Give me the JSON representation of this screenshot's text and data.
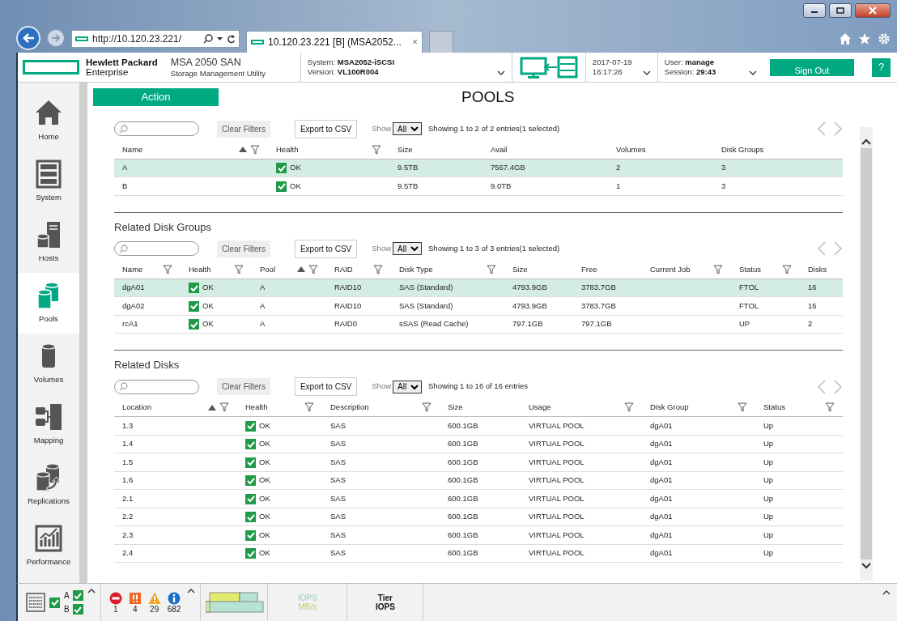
{
  "browser": {
    "address": "http://10.120.23.221/",
    "tab_title": "10.120.23.221 [B] (MSA2052...",
    "tab_close": "×"
  },
  "header": {
    "brand_line1": "Hewlett Packard",
    "brand_line2": "Enterprise",
    "product": "MSA 2050 SAN",
    "product_sub": "Storage Management Utility",
    "system_label": "System:",
    "system": "MSA2052-iSCSI",
    "version_label": "Version:",
    "version": "VL100R004",
    "date": "2017-07-19",
    "time": "16:17:26",
    "user_label": "User:",
    "user": "manage",
    "session_label": "Session:",
    "session": "29:43",
    "sign_out": "Sign Out",
    "help": "?"
  },
  "sidebar": {
    "items": [
      {
        "label": "Home",
        "selected": false
      },
      {
        "label": "System",
        "selected": false
      },
      {
        "label": "Hosts",
        "selected": false
      },
      {
        "label": "Pools",
        "selected": true
      },
      {
        "label": "Volumes",
        "selected": false
      },
      {
        "label": "Mapping",
        "selected": false
      },
      {
        "label": "Replications",
        "selected": false
      },
      {
        "label": "Performance",
        "selected": false
      }
    ]
  },
  "action_button": "Action",
  "page_title": "POOLS",
  "sections": [
    {
      "clear_filters": "Clear Filters",
      "export": "Export to CSV",
      "show_label": "Show",
      "show_value": "All",
      "summary": "Showing 1 to 2 of 2 entries(1 selected)",
      "columns": [
        {
          "label": "Name",
          "sorted": true,
          "filter": true,
          "kind": "text"
        },
        {
          "label": "Health",
          "sorted": false,
          "filter": true,
          "kind": "health"
        },
        {
          "label": "Size",
          "sorted": false,
          "filter": false,
          "kind": "text"
        },
        {
          "label": "Avail",
          "sorted": false,
          "filter": false,
          "kind": "text"
        },
        {
          "label": "Volumes",
          "sorted": false,
          "filter": false,
          "kind": "text"
        },
        {
          "label": "Disk Groups",
          "sorted": false,
          "filter": false,
          "kind": "text"
        }
      ],
      "rows": [
        {
          "selected": true,
          "cells": [
            "A",
            "OK",
            "9.5TB",
            "7567.4GB",
            "2",
            "3"
          ]
        },
        {
          "selected": false,
          "cells": [
            "B",
            "OK",
            "9.5TB",
            "9.0TB",
            "1",
            "3"
          ]
        }
      ]
    },
    {
      "title": "Related Disk Groups",
      "clear_filters": "Clear Filters",
      "export": "Export to CSV",
      "show_label": "Show",
      "show_value": "All",
      "summary": "Showing 1 to 3 of 3 entries(1 selected)",
      "columns": [
        {
          "label": "Name",
          "sorted": false,
          "filter": true,
          "kind": "text"
        },
        {
          "label": "Health",
          "sorted": false,
          "filter": true,
          "kind": "health"
        },
        {
          "label": "Pool",
          "sorted": true,
          "filter": true,
          "kind": "text"
        },
        {
          "label": "RAID",
          "sorted": false,
          "filter": true,
          "kind": "text"
        },
        {
          "label": "Disk Type",
          "sorted": false,
          "filter": true,
          "kind": "text"
        },
        {
          "label": "Size",
          "sorted": false,
          "filter": false,
          "kind": "text"
        },
        {
          "label": "Free",
          "sorted": false,
          "filter": false,
          "kind": "text"
        },
        {
          "label": "Current Job",
          "sorted": false,
          "filter": true,
          "kind": "text"
        },
        {
          "label": "Status",
          "sorted": false,
          "filter": true,
          "kind": "text"
        },
        {
          "label": "Disks",
          "sorted": false,
          "filter": false,
          "kind": "text"
        }
      ],
      "rows": [
        {
          "selected": true,
          "cells": [
            "dgA01",
            "OK",
            "A",
            "RAID10",
            "SAS (Standard)",
            "4793.9GB",
            "3783.7GB",
            "",
            "FTOL",
            "16"
          ]
        },
        {
          "selected": false,
          "cells": [
            "dgA02",
            "OK",
            "A",
            "RAID10",
            "SAS (Standard)",
            "4793.9GB",
            "3783.7GB",
            "",
            "FTOL",
            "16"
          ]
        },
        {
          "selected": false,
          "cells": [
            "rcA1",
            "OK",
            "A",
            "RAID0",
            "sSAS (Read Cache)",
            "797.1GB",
            "797.1GB",
            "",
            "UP",
            "2"
          ]
        }
      ]
    },
    {
      "title": "Related Disks",
      "clear_filters": "Clear Filters",
      "export": "Export to CSV",
      "show_label": "Show",
      "show_value": "All",
      "summary": "Showing 1 to 16 of 16 entries",
      "columns": [
        {
          "label": "Location",
          "sorted": true,
          "filter": true,
          "kind": "text"
        },
        {
          "label": "Health",
          "sorted": false,
          "filter": true,
          "kind": "health"
        },
        {
          "label": "Description",
          "sorted": false,
          "filter": true,
          "kind": "text"
        },
        {
          "label": "Size",
          "sorted": false,
          "filter": false,
          "kind": "text"
        },
        {
          "label": "Usage",
          "sorted": false,
          "filter": true,
          "kind": "text"
        },
        {
          "label": "Disk Group",
          "sorted": false,
          "filter": true,
          "kind": "text"
        },
        {
          "label": "Status",
          "sorted": false,
          "filter": true,
          "kind": "text"
        }
      ],
      "rows": [
        {
          "selected": false,
          "cells": [
            "1.3",
            "OK",
            "SAS",
            "600.1GB",
            "VIRTUAL POOL",
            "dgA01",
            "Up"
          ]
        },
        {
          "selected": false,
          "cells": [
            "1.4",
            "OK",
            "SAS",
            "600.1GB",
            "VIRTUAL POOL",
            "dgA01",
            "Up"
          ]
        },
        {
          "selected": false,
          "cells": [
            "1.5",
            "OK",
            "SAS",
            "600.1GB",
            "VIRTUAL POOL",
            "dgA01",
            "Up"
          ]
        },
        {
          "selected": false,
          "cells": [
            "1.6",
            "OK",
            "SAS",
            "600.1GB",
            "VIRTUAL POOL",
            "dgA01",
            "Up"
          ]
        },
        {
          "selected": false,
          "cells": [
            "2.1",
            "OK",
            "SAS",
            "600.1GB",
            "VIRTUAL POOL",
            "dgA01",
            "Up"
          ]
        },
        {
          "selected": false,
          "cells": [
            "2.2",
            "OK",
            "SAS",
            "600.1GB",
            "VIRTUAL POOL",
            "dgA01",
            "Up"
          ]
        },
        {
          "selected": false,
          "cells": [
            "2.3",
            "OK",
            "SAS",
            "600.1GB",
            "VIRTUAL POOL",
            "dgA01",
            "Up"
          ]
        },
        {
          "selected": false,
          "cells": [
            "2.4",
            "OK",
            "SAS",
            "600.1GB",
            "VIRTUAL POOL",
            "dgA01",
            "Up"
          ]
        }
      ]
    }
  ],
  "status_bar": {
    "controllers": [
      {
        "label": "A"
      },
      {
        "label": "B"
      }
    ],
    "alerts": [
      {
        "kind": "critical",
        "count": "1"
      },
      {
        "kind": "error",
        "count": "4"
      },
      {
        "kind": "warning",
        "count": "29"
      },
      {
        "kind": "info",
        "count": "682"
      }
    ],
    "perf_labels": [
      "IOPS",
      "MB/s"
    ],
    "tier_labels": [
      "Tier",
      "IOPS"
    ]
  }
}
